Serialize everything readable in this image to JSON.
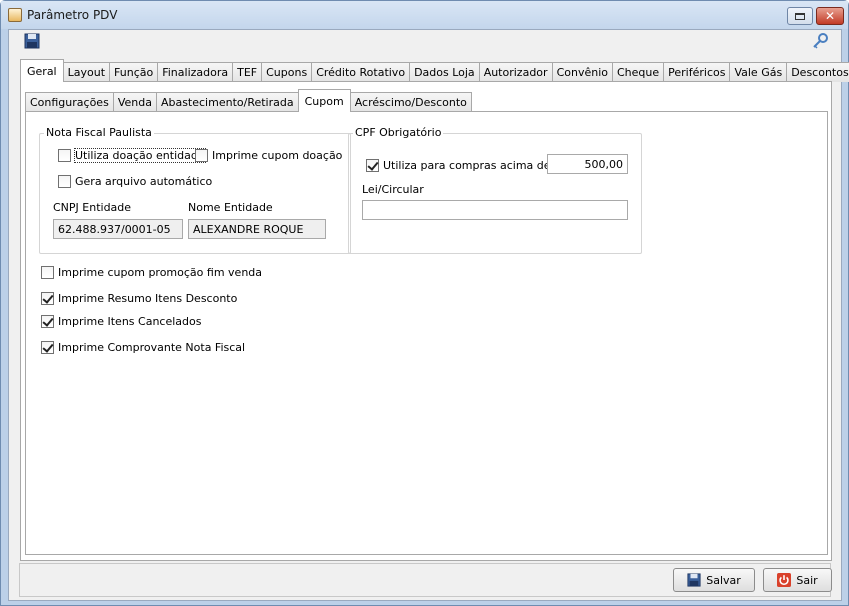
{
  "window": {
    "title": "Parâmetro PDV"
  },
  "main_tabs": [
    {
      "label": "Geral",
      "active": true
    },
    {
      "label": "Layout"
    },
    {
      "label": "Função"
    },
    {
      "label": "Finalizadora"
    },
    {
      "label": "TEF"
    },
    {
      "label": "Cupons"
    },
    {
      "label": "Crédito Rotativo"
    },
    {
      "label": "Dados Loja"
    },
    {
      "label": "Autorizador"
    },
    {
      "label": "Convênio"
    },
    {
      "label": "Cheque"
    },
    {
      "label": "Periféricos"
    },
    {
      "label": "Vale Gás"
    },
    {
      "label": "Descontos"
    }
  ],
  "sub_tabs": [
    {
      "label": "Configurações"
    },
    {
      "label": "Venda"
    },
    {
      "label": "Abastecimento/Retirada"
    },
    {
      "label": "Cupom",
      "active": true
    },
    {
      "label": "Acréscimo/Desconto"
    }
  ],
  "nota_fiscal": {
    "legend": "Nota Fiscal Paulista",
    "utiliza_doacao": {
      "label": "Utiliza doação entidade",
      "checked": false
    },
    "imprime_cupom_doacao": {
      "label": "Imprime cupom doação",
      "checked": false
    },
    "gera_arquivo": {
      "label": "Gera arquivo automático",
      "checked": false
    },
    "cnpj_label": "CNPJ Entidade",
    "cnpj_value": "62.488.937/0001-05",
    "nome_label": "Nome Entidade",
    "nome_value": "ALEXANDRE ROQUE"
  },
  "cpf": {
    "legend": "CPF Obrigatório",
    "utiliza_compras": {
      "label": "Utiliza para compras acima de R$",
      "checked": true
    },
    "valor": "500,00",
    "lei_label": "Lei/Circular",
    "lei_value": ""
  },
  "options": [
    {
      "label": "Imprime cupom promoção fim venda",
      "checked": false
    },
    {
      "label": "Imprime Resumo Itens Desconto",
      "checked": true
    },
    {
      "label": "Imprime Itens Cancelados",
      "checked": true
    },
    {
      "label": "Imprime Comprovante Nota Fiscal",
      "checked": true
    }
  ],
  "buttons": {
    "save": "Salvar",
    "exit": "Sair"
  },
  "icons": {
    "save": "floppy-disk-icon",
    "key": "key-icon",
    "exit": "power-icon"
  },
  "colors": {
    "titlebar": "#c4d6ec",
    "close": "#c23a26",
    "exit_icon": "#d9412b",
    "save_icon": "#3a5f9a"
  }
}
